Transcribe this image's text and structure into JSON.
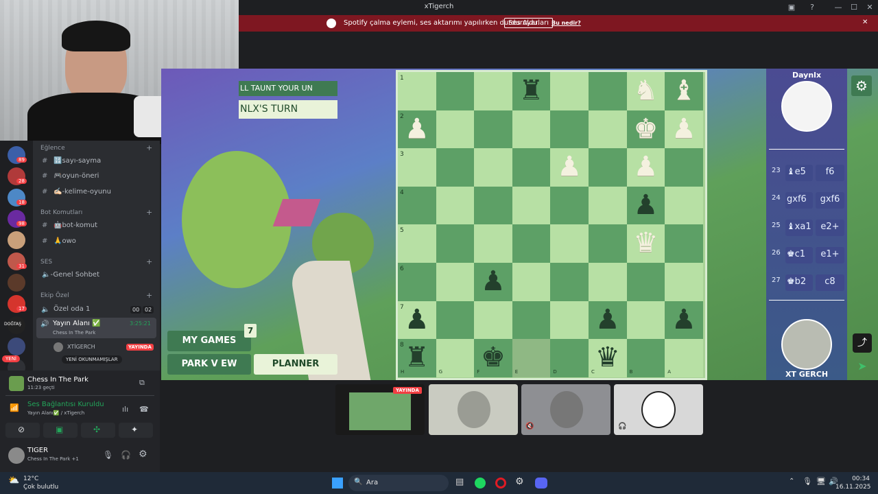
{
  "window": {
    "title": "xTigerch",
    "min": "—",
    "max": "☐",
    "close": "✕"
  },
  "spotify_bar": {
    "message": "Spotify çalma eylemi, ses aktarımı yapılırken durduruldu.",
    "settings_button": "Ses Ayarları",
    "what_link": "Bu nedir?",
    "close": "✕"
  },
  "servers": [
    {
      "badge": "89",
      "color": "#3b5fa8"
    },
    {
      "badge": "28",
      "color": "#b03a3a"
    },
    {
      "badge": "18",
      "color": "#4d88c6"
    },
    {
      "badge": "98",
      "color": "#6a2aa0"
    },
    {
      "badge": "",
      "color": "#c9a07a"
    },
    {
      "badge": "31",
      "color": "#c0584b"
    },
    {
      "badge": "",
      "color": "#5b3a2a"
    },
    {
      "badge": "17",
      "color": "#d5352d"
    },
    {
      "badge": "",
      "color": "#222",
      "label": "DOĞTAŞ"
    },
    {
      "badge": "",
      "color": "#3c4a7a"
    },
    {
      "badge": "",
      "color": "#2f3136"
    }
  ],
  "new_badge": "YENİ",
  "channels": {
    "cat1": "Eğlence",
    "ch1": "🔢sayı-sayma",
    "ch2": "🎮oyun-öneri",
    "ch3": "✍🏻-kelime-oyunu",
    "cat2": "Bot Komutları",
    "ch4": "🤖bot-komut",
    "ch5": "🙏owo",
    "cat3": "SES",
    "ch6": "🔈-Genel Sohbet",
    "cat4": "Ekip Özel",
    "ch7": "Özel oda 1",
    "ch7_count_a": "00",
    "ch7_count_b": "02",
    "ch8": "Yayın Alanı ✅",
    "ch8_time": "3:25:21",
    "ch8_sub": "Chess In The Park",
    "user1": "XTİGERCH",
    "live": "YAYINDA",
    "unread": "YENİ OKUNMAMIŞLAR"
  },
  "activity": {
    "title": "Chess In The Park",
    "sub": "11:23 geçti"
  },
  "voice": {
    "status": "Ses Bağlantısı Kuruldu",
    "sub": "Yayın Alanı✅ / xTigerch"
  },
  "user": {
    "name": "TIGER",
    "sub": "Chess In The Park +1"
  },
  "game": {
    "taunt": "LL TAUNT YOUR UN VERSE",
    "turn": "NLX'S TURN",
    "my_games": "MY GAMES",
    "badge": "7",
    "park_view": "PARK V EW",
    "planner": "PLANNER",
    "top_player": "Daynlx",
    "bottom_player": "XT GERCH",
    "rows": [
      "1",
      "2",
      "3",
      "4",
      "5",
      "6",
      "7",
      "8"
    ],
    "files": [
      "H",
      "G",
      "F",
      "E",
      "D",
      "C",
      "B",
      "A"
    ],
    "moves": [
      {
        "n": "23",
        "w": "♝e5",
        "b": "f6"
      },
      {
        "n": "24",
        "w": "gxf6",
        "b": "gxf6"
      },
      {
        "n": "25",
        "w": "♝xa1",
        "b": "e2+"
      },
      {
        "n": "26",
        "w": "♚c1",
        "b": "e1+"
      },
      {
        "n": "27",
        "w": "♚b2",
        "b": "c8"
      }
    ]
  },
  "thumbs": {
    "live": "YAYINDA"
  },
  "taskbar": {
    "weather_temp": "12°C",
    "weather_desc": "Çok bulutlu",
    "search": "Ara",
    "time": "00:34",
    "date": "16.11.2025"
  }
}
